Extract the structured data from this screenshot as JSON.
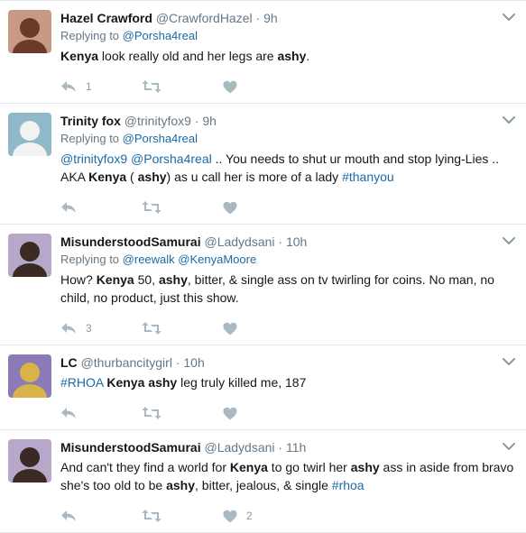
{
  "tweets": [
    {
      "name": "Hazel Crawford",
      "handle": "@CrawfordHazel",
      "time": "9h",
      "replying_label": "Replying to",
      "replying_to": [
        "@Porsha4real"
      ],
      "segments": [
        {
          "t": "Kenya",
          "s": "b"
        },
        {
          "t": " look really old and her legs are ",
          "s": "n"
        },
        {
          "t": "ashy",
          "s": "b"
        },
        {
          "t": ".",
          "s": "n"
        }
      ],
      "reply_count": "1",
      "retweet_count": "",
      "like_count": "",
      "avatar_colors": [
        "#c89a86",
        "#6b3a2a"
      ]
    },
    {
      "name": "Trinity fox",
      "handle": "@trinityfox9",
      "time": "9h",
      "replying_label": "Replying to",
      "replying_to": [
        "@Porsha4real"
      ],
      "segments": [
        {
          "t": "@trinityfox9",
          "s": "l"
        },
        {
          "t": "  ",
          "s": "n"
        },
        {
          "t": "@Porsha4real",
          "s": "l"
        },
        {
          "t": "  .. You needs to shut ur mouth and stop lying-Lies .. AKA ",
          "s": "n"
        },
        {
          "t": "Kenya",
          "s": "b"
        },
        {
          "t": " ( ",
          "s": "n"
        },
        {
          "t": "ashy",
          "s": "b"
        },
        {
          "t": ") as u call her is more of a lady ",
          "s": "n"
        },
        {
          "t": "#thanyou",
          "s": "l"
        }
      ],
      "reply_count": "",
      "retweet_count": "",
      "like_count": "",
      "avatar_colors": [
        "#8fb9c9",
        "#f2f2f2"
      ]
    },
    {
      "name": "MisunderstoodSamurai",
      "handle": "@Ladydsani",
      "time": "10h",
      "replying_label": "Replying to",
      "replying_to": [
        "@reewalk",
        "@KenyaMoore"
      ],
      "segments": [
        {
          "t": "How? ",
          "s": "n"
        },
        {
          "t": "Kenya",
          "s": "b"
        },
        {
          "t": " 50, ",
          "s": "n"
        },
        {
          "t": "ashy",
          "s": "b"
        },
        {
          "t": ", bitter, & single ass on tv twirling for coins. No man, no child, no product, just this show.",
          "s": "n"
        }
      ],
      "reply_count": "3",
      "retweet_count": "",
      "like_count": "",
      "avatar_colors": [
        "#b7a7c9",
        "#3b2a24"
      ]
    },
    {
      "name": "LC",
      "handle": "@thurbancitygirl",
      "time": "10h",
      "replying_label": "",
      "replying_to": [],
      "segments": [
        {
          "t": "#RHOA",
          "s": "l"
        },
        {
          "t": " ",
          "s": "n"
        },
        {
          "t": "Kenya",
          "s": "b"
        },
        {
          "t": " ",
          "s": "n"
        },
        {
          "t": "ashy",
          "s": "b"
        },
        {
          "t": " leg truly killed me, 187",
          "s": "n"
        }
      ],
      "reply_count": "",
      "retweet_count": "",
      "like_count": "",
      "avatar_colors": [
        "#8a7bb8",
        "#d9b24a"
      ]
    },
    {
      "name": "MisunderstoodSamurai",
      "handle": "@Ladydsani",
      "time": "11h",
      "replying_label": "",
      "replying_to": [],
      "segments": [
        {
          "t": "And can't they find a world for ",
          "s": "n"
        },
        {
          "t": "Kenya",
          "s": "b"
        },
        {
          "t": " to go twirl her ",
          "s": "n"
        },
        {
          "t": "ashy",
          "s": "b"
        },
        {
          "t": " ass in aside from bravo she's too old to be ",
          "s": "n"
        },
        {
          "t": "ashy",
          "s": "b"
        },
        {
          "t": ", bitter, jealous, & single ",
          "s": "n"
        },
        {
          "t": "#rhoa",
          "s": "l"
        }
      ],
      "reply_count": "",
      "retweet_count": "",
      "like_count": "2",
      "avatar_colors": [
        "#b7a7c9",
        "#3b2a24"
      ]
    }
  ],
  "icons": {
    "reply": "reply-icon",
    "retweet": "retweet-icon",
    "like": "heart-icon",
    "more": "chevron-down-icon"
  },
  "colors": {
    "link": "#1b6aa5",
    "muted": "#657786",
    "icon": "#aab8c2",
    "divider": "#e1e8ed"
  }
}
